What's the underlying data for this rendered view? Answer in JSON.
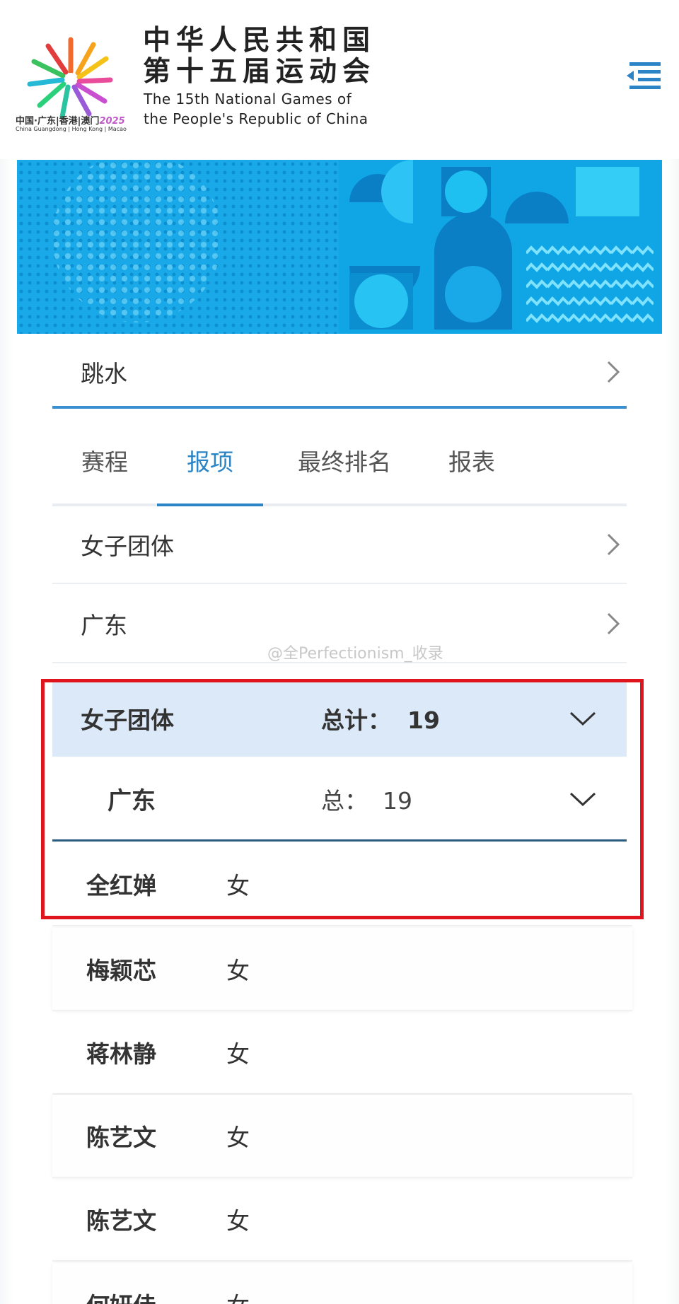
{
  "header": {
    "title_cn_line1": "中华人民共和国",
    "title_cn_line2": "第十五届运动会",
    "title_en_line1": "The 15th National Games of",
    "title_en_line2": "the People's Republic of China",
    "logo_caption_cn": "中国·广东|香港|澳门",
    "logo_caption_year": "2025",
    "logo_caption_en": "China Guangdong | Hong Kong | Macao"
  },
  "sport": {
    "label": "跳水"
  },
  "tabs": [
    {
      "label": "赛程",
      "active": false
    },
    {
      "label": "报项",
      "active": true
    },
    {
      "label": "最终排名",
      "active": false
    },
    {
      "label": "报表",
      "active": false
    }
  ],
  "filters": {
    "event": "女子团体",
    "delegation": "广东"
  },
  "watermark": "@全Perfectionism_收录",
  "group": {
    "name": "女子团体",
    "total_label": "总计：",
    "total_value": "19"
  },
  "subgroup": {
    "name": "广东",
    "total_label": "总：",
    "total_value": "19"
  },
  "athletes": [
    {
      "name": "全红婵",
      "gender": "女"
    },
    {
      "name": "梅颖芯",
      "gender": "女"
    },
    {
      "name": "蒋林静",
      "gender": "女"
    },
    {
      "name": "陈艺文",
      "gender": "女"
    },
    {
      "name": "陈艺文",
      "gender": "女"
    },
    {
      "name": "何妍佳",
      "gender": "女"
    }
  ],
  "colors": {
    "accent": "#2b84c6",
    "group_bg": "#dce9f8",
    "highlight": "#e0141c",
    "banner": "#1aa9e8"
  }
}
